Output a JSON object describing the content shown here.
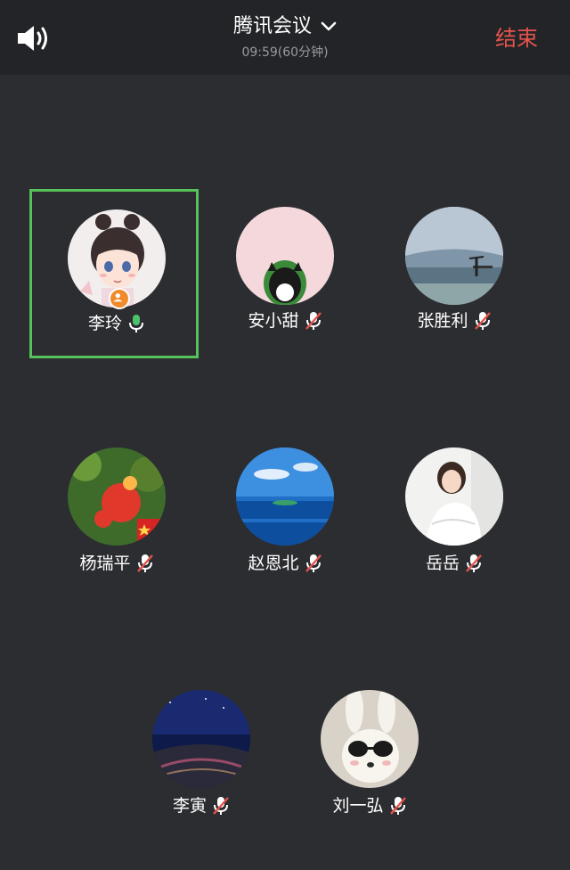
{
  "header": {
    "title": "腾讯会议",
    "subtitle": "09:59(60分钟)",
    "end_label": "结束",
    "speaker_icon": "speaker-icon",
    "dropdown_icon": "chevron-down-icon"
  },
  "colors": {
    "background": "#2c2d31",
    "header_bg": "#232427",
    "end_red": "#e5544d",
    "active_border": "#56c25a",
    "mic_on": "#4cc36a",
    "mic_off_slash": "#e5544d",
    "host_badge": "#f08a2a"
  },
  "participants": [
    {
      "name": "李玲",
      "mic": "on",
      "speaking": true,
      "host": true
    },
    {
      "name": "安小甜",
      "mic": "muted"
    },
    {
      "name": "张胜利",
      "mic": "muted"
    },
    {
      "name": "杨瑞平",
      "mic": "muted"
    },
    {
      "name": "赵恩北",
      "mic": "muted"
    },
    {
      "name": "岳岳",
      "mic": "muted"
    },
    {
      "name": "李寅",
      "mic": "muted"
    },
    {
      "name": "刘一弘",
      "mic": "muted"
    }
  ]
}
